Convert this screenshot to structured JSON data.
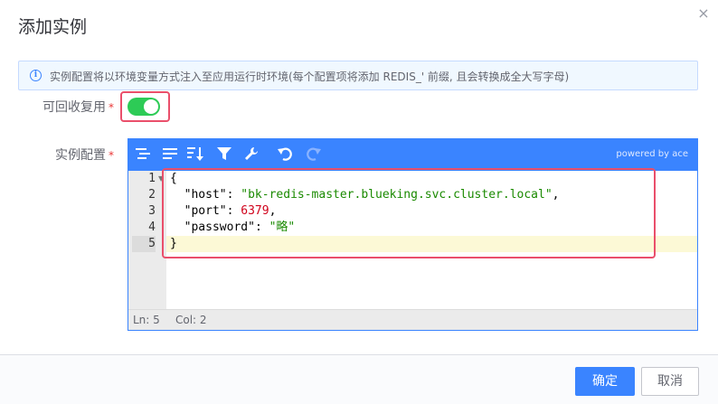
{
  "dialog": {
    "title": "添加实例",
    "close_glyph": "×"
  },
  "alert": {
    "icon": "info-icon",
    "icon_glyph": "i",
    "text": "实例配置将以环境变量方式注入至应用运行时环境(每个配置项将添加 REDIS_' 前缀, 且会转换成全大写字母)"
  },
  "form": {
    "recyclable": {
      "label": "可回收复用",
      "required_mark": "*",
      "enabled": true
    },
    "instance_config": {
      "label": "实例配置",
      "required_mark": "*"
    }
  },
  "editor": {
    "toolbar": {
      "icons": [
        "format-icon",
        "compact-icon",
        "sort-icon",
        "filter-icon",
        "repair-icon",
        "undo-icon",
        "redo-icon"
      ],
      "powered_by": "powered by ace"
    },
    "line_numbers": [
      "1",
      "2",
      "3",
      "4",
      "5"
    ],
    "lines": [
      [
        {
          "t": "punct",
          "v": "{"
        }
      ],
      [
        {
          "t": "punct",
          "v": "  "
        },
        {
          "t": "key",
          "v": "\"host\""
        },
        {
          "t": "punct",
          "v": ": "
        },
        {
          "t": "str",
          "v": "\"bk-redis-master.blueking.svc.cluster.local\""
        },
        {
          "t": "punct",
          "v": ","
        }
      ],
      [
        {
          "t": "punct",
          "v": "  "
        },
        {
          "t": "key",
          "v": "\"port\""
        },
        {
          "t": "punct",
          "v": ": "
        },
        {
          "t": "num",
          "v": "6379"
        },
        {
          "t": "punct",
          "v": ","
        }
      ],
      [
        {
          "t": "punct",
          "v": "  "
        },
        {
          "t": "key",
          "v": "\"password\""
        },
        {
          "t": "punct",
          "v": ": "
        },
        {
          "t": "str",
          "v": "\"略\""
        }
      ],
      [
        {
          "t": "punct",
          "v": "}"
        }
      ]
    ],
    "status": {
      "line": "Ln: 5",
      "col": "Col: 2"
    }
  },
  "footer": {
    "confirm_label": "确定",
    "cancel_label": "取消"
  },
  "colors": {
    "accent": "#3a84ff",
    "switch_on": "#2dcb56",
    "highlight": "#ea4f6b"
  }
}
